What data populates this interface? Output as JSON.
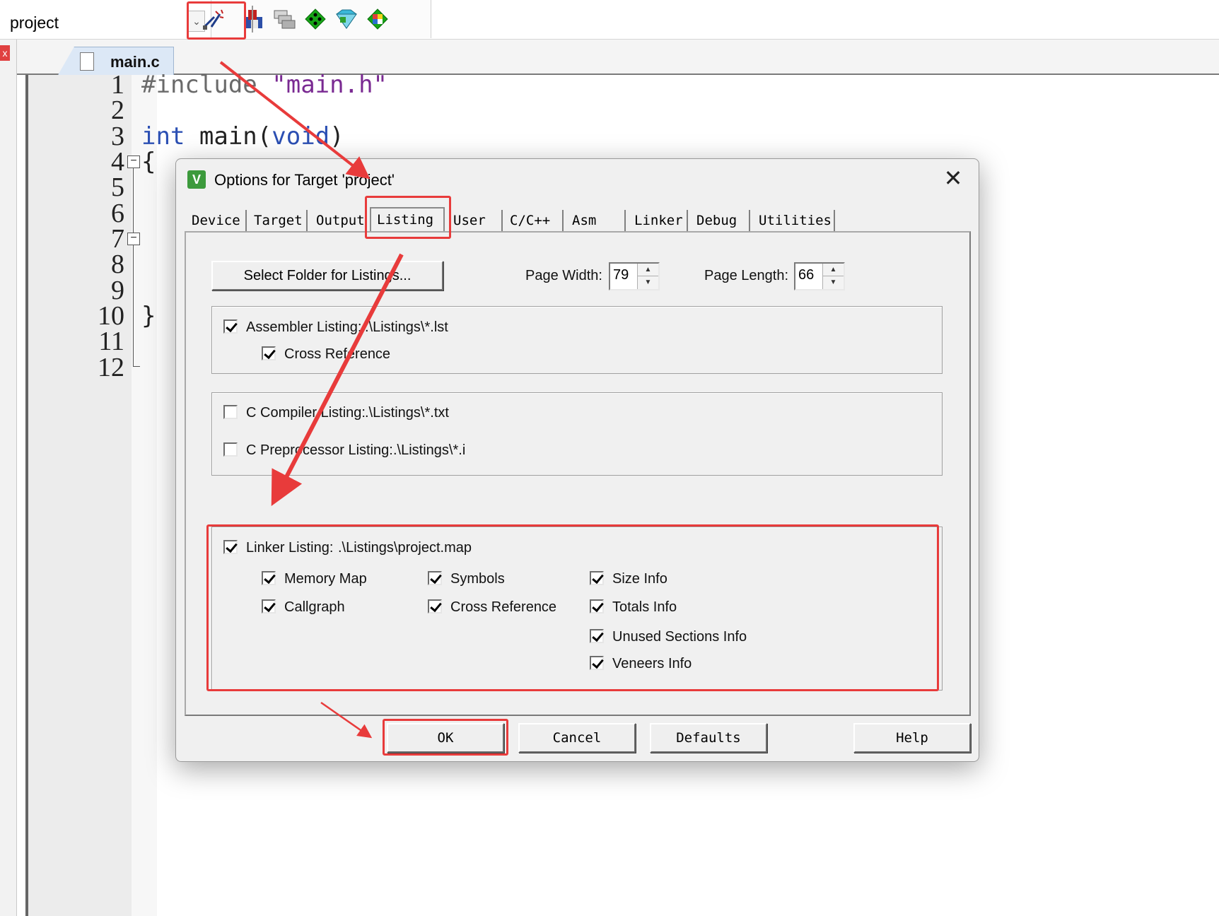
{
  "toolbar": {
    "target_value": "project",
    "buttons": [
      "options-for-target-icon",
      "load-icon",
      "manage-components-icon",
      "select-device-icon",
      "pack-installer-icon",
      "run-time-environment-icon"
    ]
  },
  "tabbar": {
    "file_tab": "main.c"
  },
  "editor": {
    "line_numbers": [
      "1",
      "2",
      "3",
      "4",
      "5",
      "6",
      "7",
      "8",
      "9",
      "10",
      "11",
      "12"
    ],
    "code": {
      "l1_directive": "#include",
      "l1_string": "\"main.h\"",
      "l3_type": "int",
      "l3_name": " main(",
      "l3_param": "void",
      "l3_close": ")",
      "l4_open": "{",
      "l10_close": "}"
    }
  },
  "dialog": {
    "title": "Options for Target 'project'",
    "close_glyph": "✕",
    "tabs": [
      "Device",
      "Target",
      "Output",
      "Listing",
      "User",
      "C/C++",
      "Asm",
      "Linker",
      "Debug",
      "Utilities"
    ],
    "active_tab": "Listing",
    "select_folder_label": "Select Folder for Listings...",
    "page_width_label": "Page Width:",
    "page_width_value": "79",
    "page_length_label": "Page Length:",
    "page_length_value": "66",
    "assembler_listing": {
      "label": "Assembler Listing:",
      "path": ".\\Listings\\*.lst",
      "checked": true
    },
    "asm_cross_reference": {
      "label": "Cross Reference",
      "checked": true
    },
    "c_compiler_listing": {
      "label": "C Compiler Listing:",
      "path": ".\\Listings\\*.txt",
      "checked": false
    },
    "c_preprocessor_listing": {
      "label": "C Preprocessor Listing:",
      "path": ".\\Listings\\*.i",
      "checked": false
    },
    "linker_listing": {
      "label": "Linker Listing:",
      "path": ".\\Listings\\project.map",
      "checked": true
    },
    "linker_options": [
      {
        "label": "Memory Map",
        "checked": true
      },
      {
        "label": "Symbols",
        "checked": true
      },
      {
        "label": "Size Info",
        "checked": true
      },
      {
        "label": "Callgraph",
        "checked": true
      },
      {
        "label": "Cross Reference",
        "checked": true
      },
      {
        "label": "Totals Info",
        "checked": true
      },
      {
        "label": "Unused Sections Info",
        "checked": true
      },
      {
        "label": "Veneers Info",
        "checked": true
      }
    ],
    "buttons": {
      "ok": "OK",
      "cancel": "Cancel",
      "defaults": "Defaults",
      "help": "Help"
    }
  },
  "colors": {
    "annotation": "#e83b3b",
    "keyword": "#2b4fb3",
    "string": "#7a2a92",
    "check_icon": "#3c9a3c"
  }
}
